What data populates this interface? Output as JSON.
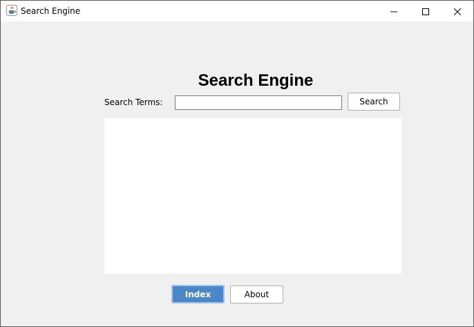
{
  "window": {
    "title": "Search Engine",
    "icon": "java-cup-icon",
    "controls": [
      "minimize-icon",
      "maximize-icon",
      "close-icon"
    ]
  },
  "main": {
    "heading": "Search Engine",
    "search_label": "Search Terms:",
    "search_value": "",
    "search_button": "Search",
    "results_text": ""
  },
  "footer": {
    "index_button": "Index",
    "about_button": "About"
  },
  "colors": {
    "background": "#f0f0f0",
    "primary_button": "#4a86c8"
  }
}
